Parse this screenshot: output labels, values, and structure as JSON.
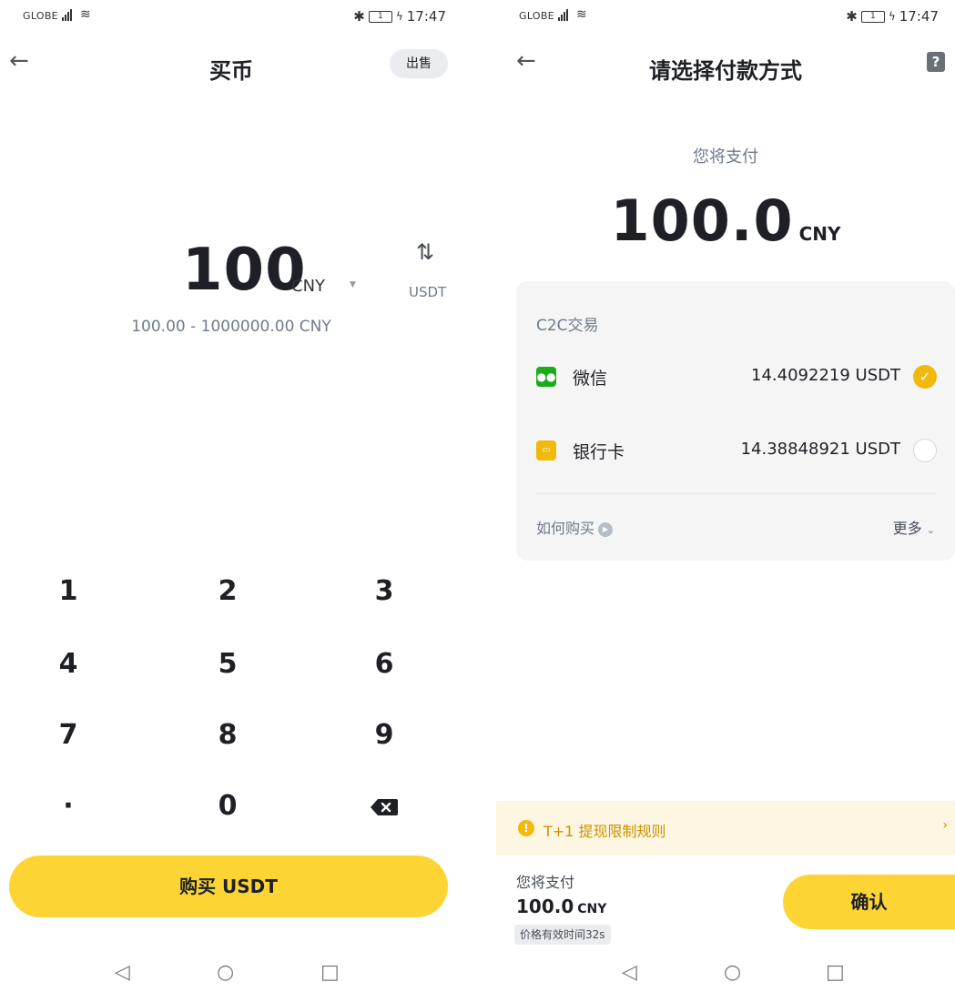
{
  "left": {
    "status": {
      "carrier": "GLOBE",
      "battery": "1",
      "time": "17:47"
    },
    "header": {
      "title": "买币",
      "sell_label": "出售"
    },
    "amount": {
      "value": "100",
      "currency": "CNY",
      "swap_label": "USDT",
      "range": "100.00 - 1000000.00 CNY"
    },
    "keypad": {
      "keys": [
        "1",
        "2",
        "3",
        "4",
        "5",
        "6",
        "7",
        "8",
        "9",
        "·",
        "0"
      ]
    },
    "buy_button": "购买 USDT"
  },
  "right": {
    "status": {
      "carrier": "GLOBE",
      "battery": "1",
      "time": "17:47"
    },
    "header": {
      "title": "请选择付款方式"
    },
    "pay_label": "您将支付",
    "pay_amount": "100.0",
    "pay_currency": "CNY",
    "card": {
      "title": "C2C交易",
      "methods": [
        {
          "name": "微信",
          "value": "14.4092219 USDT",
          "selected": true
        },
        {
          "name": "银行卡",
          "value": "14.38848921 USDT",
          "selected": false
        }
      ],
      "how_to_buy": "如何购买",
      "more": "更多"
    },
    "notice": "T+1 提现限制规则",
    "footer": {
      "label": "您将支付",
      "amount": "100.0",
      "currency": "CNY",
      "timer": "价格有效时间32s",
      "confirm": "确认"
    }
  },
  "colors": {
    "accent": "#fcd535",
    "check": "#f0b90b",
    "wechat": "#1aad19",
    "bank": "#f0b90b",
    "notice_bg": "#fdf6e2"
  }
}
